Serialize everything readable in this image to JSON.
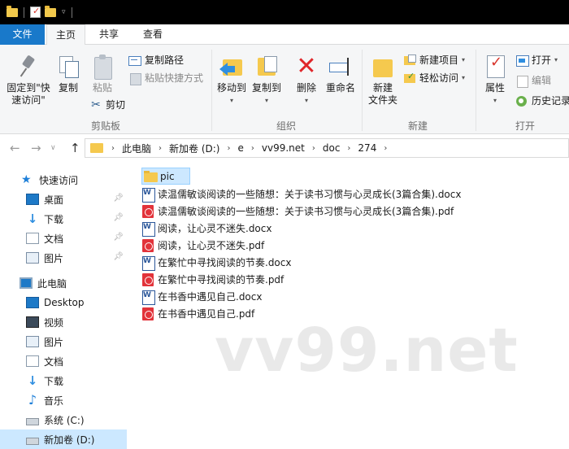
{
  "window": {
    "quick_access_icons": [
      "folder-icon",
      "properties-icon",
      "new-folder-icon",
      "customize-dropdown-icon"
    ]
  },
  "tabs": [
    "文件",
    "主页",
    "共享",
    "查看"
  ],
  "ribbon": {
    "clipboard": {
      "pin_label_1": "固定到\"快",
      "pin_label_2": "速访问\"",
      "copy": "复制",
      "paste": "粘贴",
      "copy_path": "复制路径",
      "paste_shortcut": "粘贴快捷方式",
      "cut": "剪切",
      "group": "剪贴板"
    },
    "organize": {
      "move_to": "移动到",
      "copy_to": "复制到",
      "delete": "删除",
      "rename": "重命名",
      "group": "组织"
    },
    "new": {
      "new_folder_1": "新建",
      "new_folder_2": "文件夹",
      "new_item": "新建项目",
      "easy_access": "轻松访问",
      "group": "新建"
    },
    "open": {
      "properties": "属性",
      "open": "打开",
      "edit": "编辑",
      "history": "历史记录",
      "group": "打开"
    }
  },
  "address": {
    "crumbs": [
      "此电脑",
      "新加卷 (D:)",
      "e",
      "vv99.net",
      "doc",
      "274"
    ]
  },
  "nav_pane": {
    "quick_access": "快速访问",
    "qa_items": [
      "桌面",
      "下载",
      "文档",
      "图片"
    ],
    "this_pc": "此电脑",
    "pc_items": [
      "Desktop",
      "视频",
      "图片",
      "文档",
      "下载",
      "音乐",
      "系统 (C:)",
      "新加卷 (D:)"
    ]
  },
  "files": [
    {
      "name": "pic",
      "type": "folder"
    },
    {
      "name": "读温儒敏谈阅读的一些随想：关于读书习惯与心灵成长(3篇合集).docx",
      "type": "word"
    },
    {
      "name": "读温儒敏谈阅读的一些随想：关于读书习惯与心灵成长(3篇合集).pdf",
      "type": "pdf"
    },
    {
      "name": "阅读，让心灵不迷失.docx",
      "type": "word"
    },
    {
      "name": "阅读，让心灵不迷失.pdf",
      "type": "pdf"
    },
    {
      "name": "在繁忙中寻找阅读的节奏.docx",
      "type": "word"
    },
    {
      "name": "在繁忙中寻找阅读的节奏.pdf",
      "type": "pdf"
    },
    {
      "name": "在书香中遇见自己.docx",
      "type": "word"
    },
    {
      "name": "在书香中遇见自己.pdf",
      "type": "pdf"
    }
  ],
  "watermark": "vv99.net",
  "colors": {
    "accent": "#1979ca",
    "selection": "#cce8ff",
    "folder": "#f5c94e",
    "pdf": "#e2333a",
    "word": "#2b579a"
  }
}
